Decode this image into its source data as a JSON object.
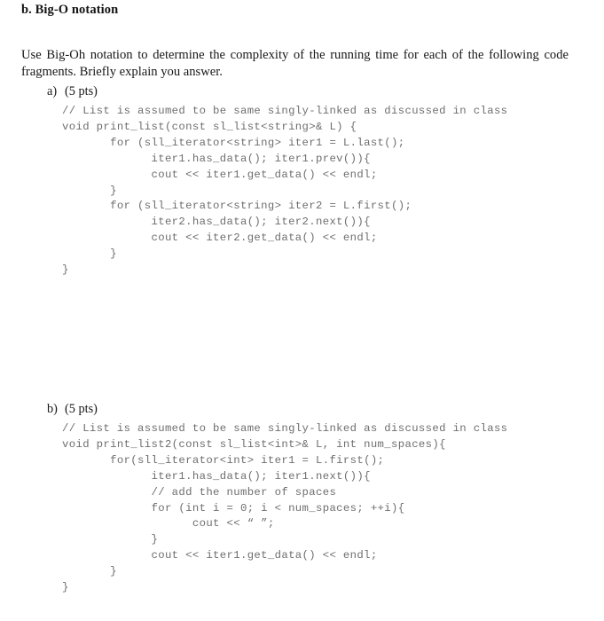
{
  "heading": "b. Big-O notation",
  "intro": "Use Big-Oh notation to determine the complexity of the running time for each of the following code fragments. Briefly explain you answer.",
  "questions": [
    {
      "label": "a)",
      "points": "(5 pts)",
      "code": "// List is assumed to be same singly-linked as discussed in class\nvoid print_list(const sl_list<string>& L) {\n       for (sll_iterator<string> iter1 = L.last();\n             iter1.has_data(); iter1.prev()){\n             cout << iter1.get_data() << endl;\n       }\n       for (sll_iterator<string> iter2 = L.first();\n             iter2.has_data(); iter2.next()){\n             cout << iter2.get_data() << endl;\n       }\n}"
    },
    {
      "label": "b)",
      "points": "(5 pts)",
      "code": "// List is assumed to be same singly-linked as discussed in class\nvoid print_list2(const sl_list<int>& L, int num_spaces){\n       for(sll_iterator<int> iter1 = L.first();\n             iter1.has_data(); iter1.next()){\n             // add the number of spaces\n             for (int i = 0; i < num_spaces; ++i){\n                   cout << “ ”;\n             }\n             cout << iter1.get_data() << endl;\n       }\n}"
    }
  ]
}
